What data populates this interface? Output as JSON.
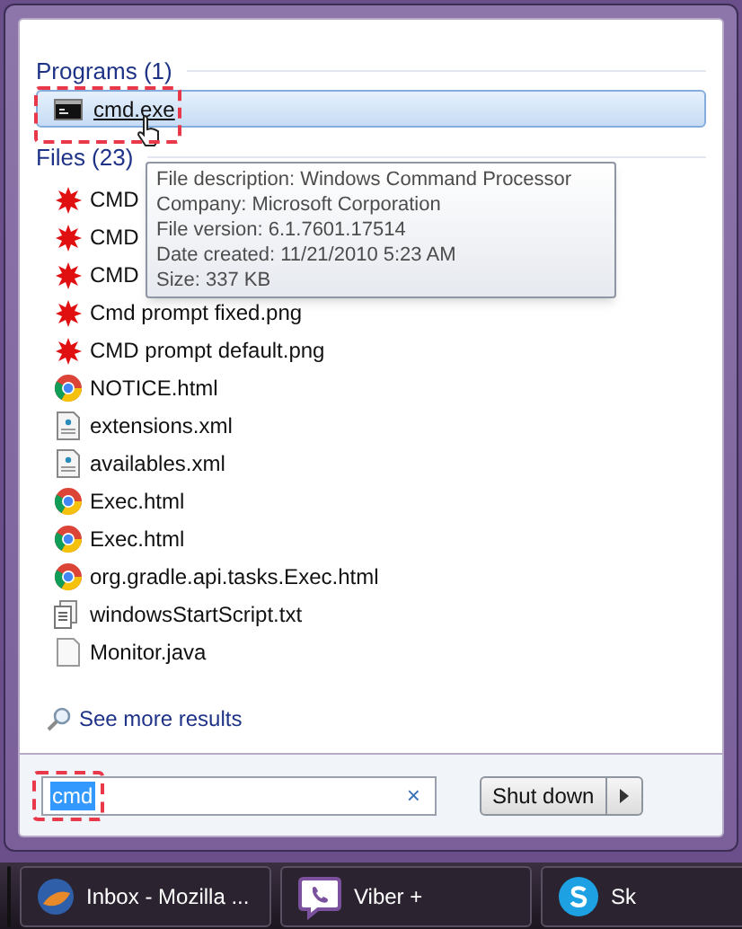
{
  "programs": {
    "heading": "Programs (1)",
    "items": [
      {
        "label": "cmd.exe",
        "selected": true
      }
    ]
  },
  "files": {
    "heading": "Files (23)",
    "items": [
      {
        "label": "CMD",
        "kind": "image"
      },
      {
        "label": "CMD",
        "kind": "image"
      },
      {
        "label": "CMD",
        "kind": "image"
      },
      {
        "label": "Cmd prompt fixed.png",
        "kind": "image"
      },
      {
        "label": "CMD prompt default.png",
        "kind": "image"
      },
      {
        "label": "NOTICE.html",
        "kind": "web"
      },
      {
        "label": "extensions.xml",
        "kind": "xml"
      },
      {
        "label": "availables.xml",
        "kind": "xml"
      },
      {
        "label": "Exec.html",
        "kind": "web"
      },
      {
        "label": "Exec.html",
        "kind": "web"
      },
      {
        "label": "org.gradle.api.tasks.Exec.html",
        "kind": "web"
      },
      {
        "label": "windowsStartScript.txt",
        "kind": "text"
      },
      {
        "label": "Monitor.java",
        "kind": "blank"
      }
    ]
  },
  "tooltip": [
    "File description: Windows Command Processor",
    "Company: Microsoft Corporation",
    "File version: 6.1.7601.17514",
    "Date created: 11/21/2010 5:23 AM",
    "Size: 337 KB"
  ],
  "see_more": "See more results",
  "search": {
    "value": "cmd",
    "clear": "×"
  },
  "shutdown": {
    "label": "Shut down"
  },
  "taskbar": [
    {
      "label": "Inbox - Mozilla ...",
      "kind": "mail"
    },
    {
      "label": "Viber +",
      "kind": "viber"
    },
    {
      "label": "Sk",
      "kind": "skype"
    }
  ]
}
